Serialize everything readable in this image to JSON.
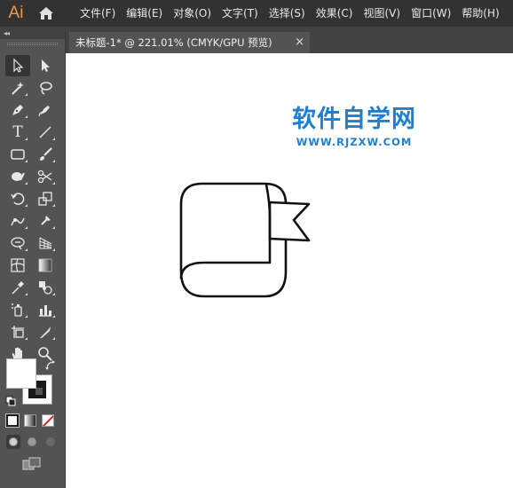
{
  "app": {
    "logo": "Ai",
    "home_icon": "home-icon"
  },
  "menu": {
    "items": [
      {
        "label": "文件(F)"
      },
      {
        "label": "编辑(E)"
      },
      {
        "label": "对象(O)"
      },
      {
        "label": "文字(T)"
      },
      {
        "label": "选择(S)"
      },
      {
        "label": "效果(C)"
      },
      {
        "label": "视图(V)"
      },
      {
        "label": "窗口(W)"
      },
      {
        "label": "帮助(H)"
      }
    ]
  },
  "tools_panel": {
    "collapse_glyph": "◂◂",
    "rows": [
      [
        "selection-tool-icon",
        "direct-selection-tool-icon"
      ],
      [
        "magic-wand-tool-icon",
        "lasso-tool-icon"
      ],
      [
        "pen-tool-icon",
        "curvature-tool-icon"
      ],
      [
        "type-tool-icon",
        "line-segment-tool-icon"
      ],
      [
        "rectangle-tool-icon",
        "paintbrush-tool-icon"
      ],
      [
        "shaper-tool-icon",
        "scissors-tool-icon"
      ],
      [
        "rotate-tool-icon",
        "scale-tool-icon"
      ],
      [
        "puppet-warp-tool-icon",
        "free-transform-tool-icon"
      ],
      [
        "shape-builder-tool-icon",
        "perspective-grid-tool-icon"
      ],
      [
        "mesh-tool-icon",
        "gradient-tool-icon"
      ],
      [
        "eyedropper-tool-icon",
        "blend-tool-icon"
      ],
      [
        "symbol-sprayer-tool-icon",
        "column-graph-tool-icon"
      ],
      [
        "artboard-tool-icon",
        "slice-tool-icon"
      ],
      [
        "hand-tool-icon",
        "zoom-tool-icon"
      ]
    ],
    "type_tool_glyph": "T"
  },
  "colors": {
    "fill": "#ffffff",
    "stroke": "#1a1a1a",
    "accent": "#1e7fd0",
    "logo": "#f29a4b"
  },
  "document": {
    "tab_title": "未标题-1* @ 221.01% (CMYK/GPU 预览)",
    "close_glyph": "×"
  },
  "canvas": {
    "watermark_title": "软件自学网",
    "watermark_url": "WWW.RJZXW.COM"
  }
}
